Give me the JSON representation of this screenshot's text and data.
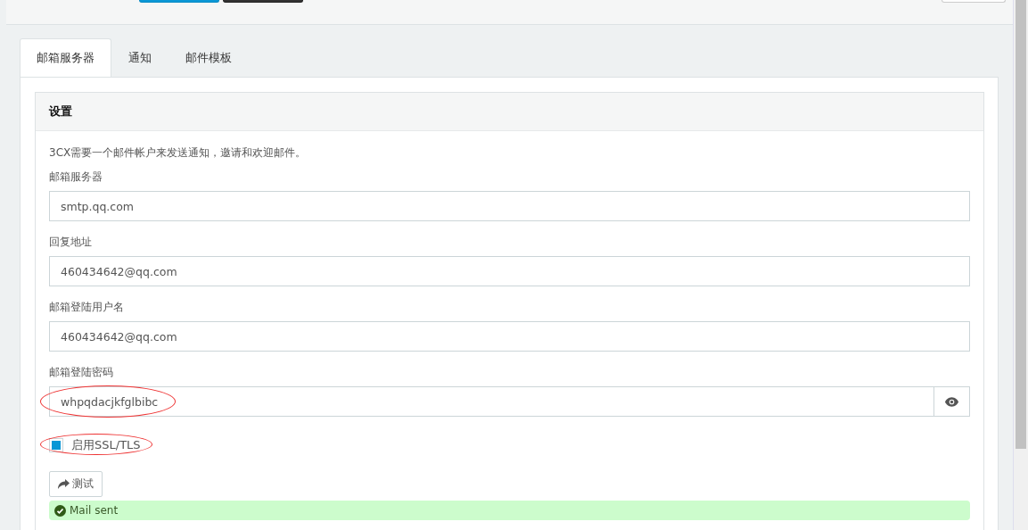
{
  "tabs": [
    {
      "label": "邮箱服务器",
      "selected": true
    },
    {
      "label": "通知",
      "selected": false
    },
    {
      "label": "邮件模板",
      "selected": false
    }
  ],
  "card": {
    "title": "设置",
    "intro": "3CX需要一个邮件帐户来发送通知，邀请和欢迎邮件。",
    "fields": [
      {
        "label": "邮箱服务器",
        "value": "smtp.qq.com",
        "kind": "text",
        "annotated": false
      },
      {
        "label": "回复地址",
        "value": "460434642@qq.com",
        "kind": "text",
        "annotated": false
      },
      {
        "label": "邮箱登陆用户名",
        "value": "460434642@qq.com",
        "kind": "text",
        "annotated": false
      },
      {
        "label": "邮箱登陆密码",
        "value": "whpqdacjkfglbibc",
        "kind": "password",
        "annotated": true
      }
    ],
    "ssl": {
      "label": "启用SSL/TLS",
      "checked": true,
      "annotated": true
    },
    "test_button": "测试",
    "alert": "Mail sent"
  }
}
